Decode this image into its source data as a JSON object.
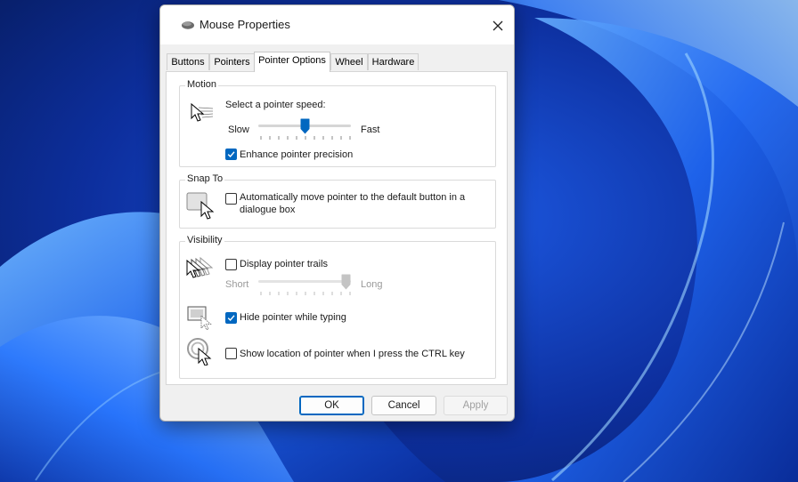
{
  "window": {
    "title": "Mouse Properties",
    "title_icon": "mouse-icon",
    "close_icon": "close-icon"
  },
  "tabs": [
    {
      "label": "Buttons",
      "active": false
    },
    {
      "label": "Pointers",
      "active": false
    },
    {
      "label": "Pointer Options",
      "active": true
    },
    {
      "label": "Wheel",
      "active": false
    },
    {
      "label": "Hardware",
      "active": false
    }
  ],
  "motion": {
    "group_label": "Motion",
    "prompt": "Select a pointer speed:",
    "slow_label": "Slow",
    "fast_label": "Fast",
    "speed_fraction": 0.5,
    "enhance_label": "Enhance pointer precision",
    "enhance_checked": true
  },
  "snap_to": {
    "group_label": "Snap To",
    "label_line1": "Automatically move pointer to the default button in a",
    "label_line2": "dialogue box",
    "checked": false
  },
  "visibility": {
    "group_label": "Visibility",
    "trails_label": "Display pointer trails",
    "trails_checked": false,
    "short_label": "Short",
    "long_label": "Long",
    "trail_length_fraction": 1.0,
    "trail_slider_enabled": false,
    "hide_label": "Hide pointer while typing",
    "hide_checked": true,
    "ctrl_label": "Show location of pointer when I press the CTRL key",
    "ctrl_checked": false
  },
  "buttons": {
    "ok": "OK",
    "cancel": "Cancel",
    "apply": "Apply",
    "apply_enabled": false
  },
  "colors": {
    "accent": "#0067c0",
    "wallpaper": "#0a2a8c"
  }
}
